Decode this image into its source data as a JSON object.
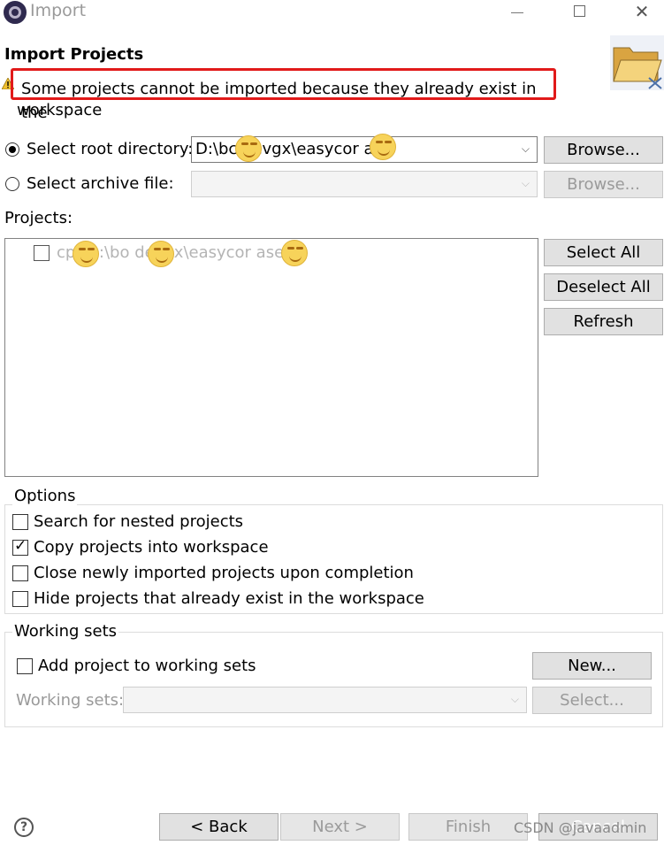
{
  "window": {
    "title": "Import",
    "minimize_symbol": "",
    "close_symbol": "✕"
  },
  "header": {
    "title": "Import Projects",
    "warning_line1": "Some projects cannot be imported because they already exist in the",
    "warning_line2": "workspace",
    "warning_icon": "warning-icon",
    "folder_icon": "folder-icon",
    "highlight_color": "#e11a1a"
  },
  "source": {
    "root_dir_label": "Select root directory:",
    "root_dir_value": "D:\\bc   devgx\\easycor    ase",
    "archive_label": "Select archive file:",
    "archive_value": "",
    "browse_label": "Browse...",
    "browse2_label": "Browse..."
  },
  "projects": {
    "label": "Projects:",
    "items": [
      {
        "name": "cp   (D:\\bo   devgx\\easycor    ase)",
        "checked": false,
        "disabled": true
      }
    ],
    "select_all": "Select All",
    "deselect_all": "Deselect All",
    "refresh": "Refresh"
  },
  "options": {
    "title": "Options",
    "items": [
      {
        "label": "Search for nested projects",
        "checked": false
      },
      {
        "label": "Copy projects into workspace",
        "checked": true
      },
      {
        "label": "Close newly imported projects upon completion",
        "checked": false
      },
      {
        "label": "Hide projects that already exist in the workspace",
        "checked": false
      }
    ]
  },
  "working_sets": {
    "title": "Working sets",
    "add_label": "Add project to working sets",
    "add_checked": false,
    "new_button": "New...",
    "sets_label": "Working sets:",
    "sets_value": "",
    "select_button": "Select..."
  },
  "footer": {
    "help": "?",
    "back": "< Back",
    "next": "Next >",
    "finish": "Finish",
    "cancel": "Cancel",
    "watermark": "CSDN @javaadmin"
  }
}
